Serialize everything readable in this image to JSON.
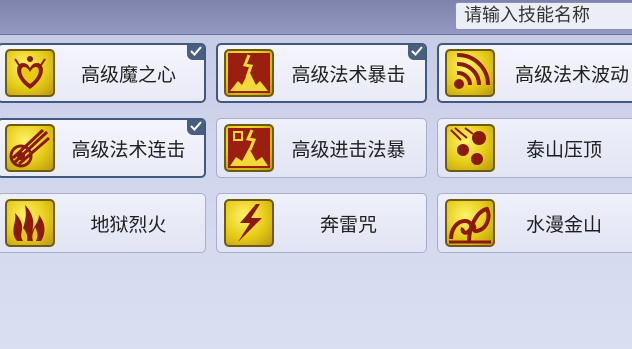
{
  "search": {
    "placeholder": "请输入技能名称"
  },
  "skills": [
    {
      "label": "高级魔之心",
      "icon": "magic-heart-icon",
      "selected": true
    },
    {
      "label": "高级法术暴击",
      "icon": "spell-crit-icon",
      "selected": true
    },
    {
      "label": "高级法术波动",
      "icon": "spell-wave-icon",
      "selected": true
    },
    {
      "label": "高级法术连击",
      "icon": "spell-combo-icon",
      "selected": true
    },
    {
      "label": "高级进击法暴",
      "icon": "advance-crit-icon",
      "selected": false
    },
    {
      "label": "泰山压顶",
      "icon": "falling-rocks-icon",
      "selected": false
    },
    {
      "label": "地狱烈火",
      "icon": "hellfire-icon",
      "selected": false
    },
    {
      "label": "奔雷咒",
      "icon": "lightning-icon",
      "selected": false
    },
    {
      "label": "水漫金山",
      "icon": "water-flood-icon",
      "selected": false
    }
  ],
  "colors": {
    "icon_bg": "#e5cb16",
    "icon_art": "#8a1a0e",
    "selected_border": "#3f5a7c"
  }
}
